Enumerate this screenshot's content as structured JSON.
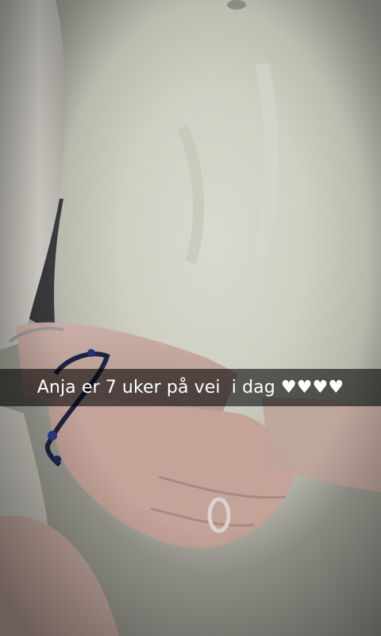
{
  "snap": {
    "caption": "Anja er 7 uker på vei  i dag ♥♥♥♥",
    "caption_bar_color": "#000000",
    "caption_text_color": "#ffffff"
  }
}
